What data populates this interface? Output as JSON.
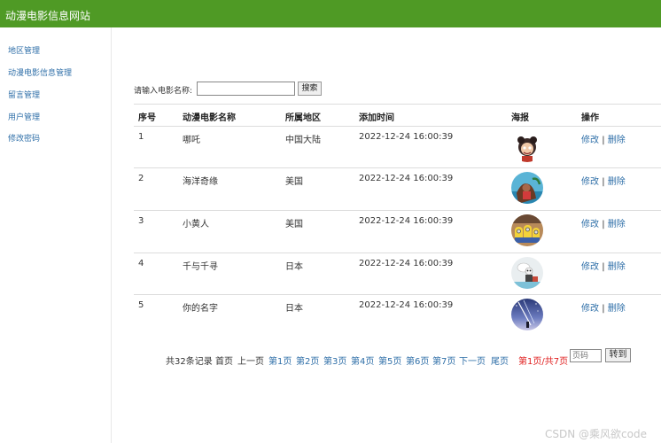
{
  "header": {
    "title": "动漫电影信息网站"
  },
  "sidebar": {
    "items": [
      "地区管理",
      "动漫电影信息管理",
      "留言管理",
      "用户管理",
      "修改密码"
    ]
  },
  "search": {
    "label": "请输入电影名称:",
    "value": "",
    "button": "搜索"
  },
  "table": {
    "headers": [
      "序号",
      "动漫电影名称",
      "所属地区",
      "添加时间",
      "海报",
      "操作"
    ],
    "rows": [
      {
        "no": "1",
        "name": "哪吒",
        "region": "中国大陆",
        "time": "2022-12-24 16:00:39",
        "poster": "nezha-poster"
      },
      {
        "no": "2",
        "name": "海洋奇缘",
        "region": "美国",
        "time": "2022-12-24 16:00:39",
        "poster": "moana-poster"
      },
      {
        "no": "3",
        "name": "小黄人",
        "region": "美国",
        "time": "2022-12-24 16:00:39",
        "poster": "minions-poster"
      },
      {
        "no": "4",
        "name": "千与千寻",
        "region": "日本",
        "time": "2022-12-24 16:00:39",
        "poster": "spirited-away-poster"
      },
      {
        "no": "5",
        "name": "你的名字",
        "region": "日本",
        "time": "2022-12-24 16:00:39",
        "poster": "your-name-poster"
      }
    ],
    "edit_label": "修改",
    "sep": "|",
    "delete_label": "删除"
  },
  "pager": {
    "total": "共32条记录",
    "first": "首页",
    "prev": "上一页",
    "pages": [
      "第1页",
      "第2页",
      "第3页",
      "第4页",
      "第5页",
      "第6页",
      "第7页"
    ],
    "next": "下一页",
    "last": "尾页",
    "current": "第1页/共7页",
    "input_placeholder": "页码",
    "go": "转到"
  },
  "watermark": "CSDN @乘风欲code",
  "colors": {
    "header_bg": "#4f9a25",
    "link": "#2f6fa8",
    "current_page": "#e02020"
  }
}
